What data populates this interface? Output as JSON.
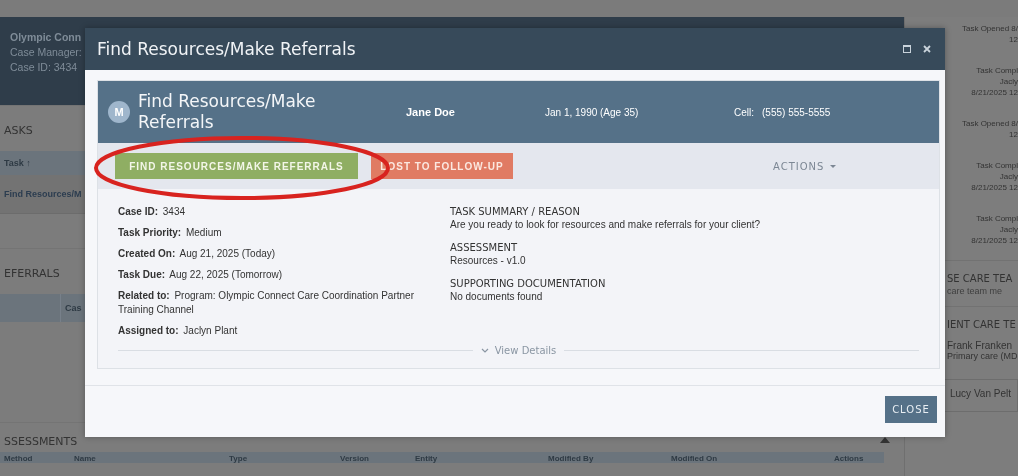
{
  "page": {
    "header": {
      "lines": [
        "Olympic Conn",
        "Case Manager:",
        "Case ID: 3434"
      ]
    },
    "tasks": {
      "title": "ASKS",
      "columns": [
        "Task ↑"
      ],
      "rows": [
        "Find Resources/M"
      ]
    },
    "referrals": {
      "title": "EFERRALS",
      "columns": [
        "Cas"
      ]
    },
    "assessments": {
      "title": "SSESSMENTS",
      "expanded": true,
      "columns": [
        "Method",
        "Name",
        "Type",
        "Version",
        "Entity",
        "Modified By",
        "Modified On",
        "Actions"
      ]
    }
  },
  "sidebar": {
    "activity": [
      {
        "lines": [
          "Task Opened 8/",
          "12"
        ]
      },
      {
        "lines": [
          "Task Compl",
          "Jacly",
          "8/21/2025 12"
        ]
      },
      {
        "lines": [
          "Task Opened 8/",
          "12"
        ]
      },
      {
        "lines": [
          "Task Compl",
          "Jacly",
          "8/21/2025 12"
        ]
      },
      {
        "lines": [
          "Task Compl",
          "Jacly",
          "8/21/2025 12"
        ]
      }
    ],
    "sections": [
      {
        "title": "SE CARE TEA",
        "placeholder": "care team me"
      },
      {
        "title": "IENT CARE TE",
        "members": [
          {
            "name": "Frank Franken",
            "role": "Primary care (MD",
            "kind": "row"
          },
          {
            "name": "Lucy Van Pelt",
            "kind": "card"
          }
        ]
      }
    ]
  },
  "modal": {
    "title": "Find Resources/Make Referrals",
    "task": {
      "avatar": "M",
      "title": "Find Resources/Make Referrals",
      "client": "Jane Doe",
      "dob": "Jan 1, 1990 (Age 35)",
      "phone_label": "Cell:",
      "phone": "(555) 555-5555"
    },
    "actions": [
      {
        "label": "FIND RESOURCES/MAKE REFERRALS",
        "kind": "success"
      },
      {
        "label": "LOST TO FOLLOW-UP",
        "kind": "danger"
      }
    ],
    "menu": "ACTIONS",
    "details": [
      {
        "label": "Case ID:",
        "value": "3434"
      },
      {
        "label": "Task Priority:",
        "value": "Medium"
      },
      {
        "label": "Created On:",
        "value": "Aug 21, 2025 (Today)"
      },
      {
        "label": "Task Due:",
        "value": "Aug 22, 2025 (Tomorrow)"
      },
      {
        "label": "Related to:",
        "value": "Program: Olympic Connect Care Coordination Partner Training Channel"
      },
      {
        "label": "Assigned to:",
        "value": "Jaclyn Plant"
      }
    ],
    "sections": [
      {
        "title": "TASK SUMMARY / REASON",
        "text": "Are you ready to look for resources and make referrals for your client?"
      },
      {
        "title": "ASSESSMENT",
        "text": "Resources - v1.0"
      },
      {
        "title": "SUPPORTING DOCUMENTATION",
        "text": "No documents found"
      }
    ],
    "view_details": "View Details",
    "close": "CLOSE"
  },
  "highlight": {
    "kind": "ellipse"
  }
}
